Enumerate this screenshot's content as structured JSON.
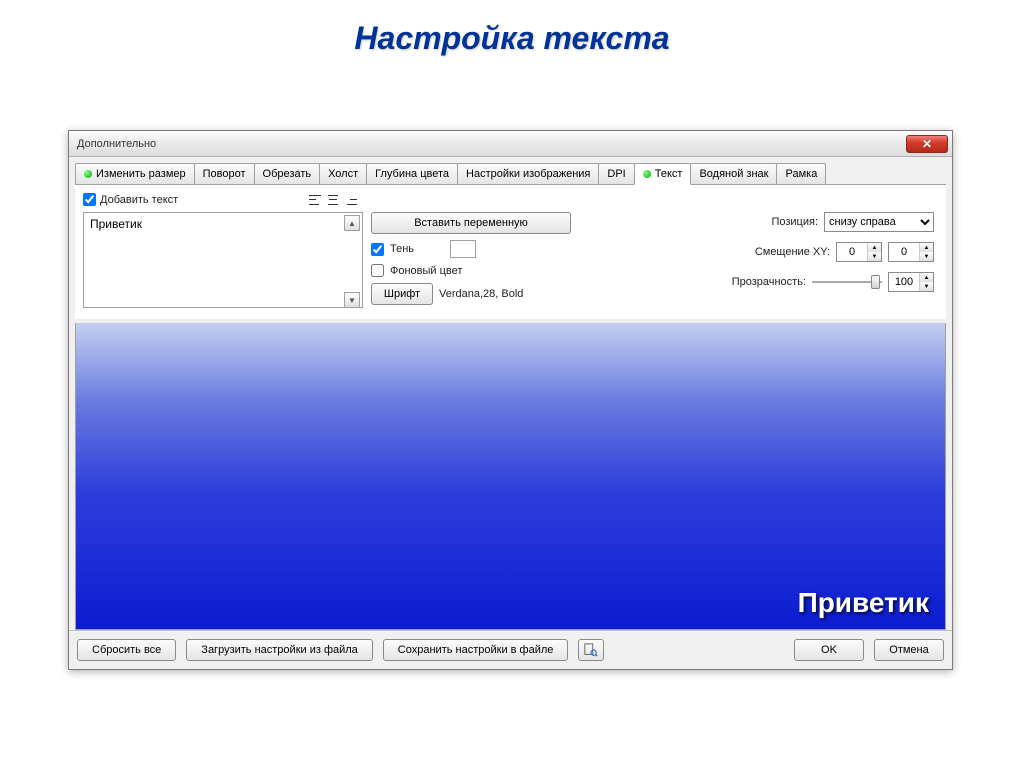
{
  "slide_title": "Настройка текста",
  "window": {
    "title": "Дополнительно"
  },
  "tabs": [
    {
      "label": "Изменить размер",
      "indicator": true
    },
    {
      "label": "Поворот"
    },
    {
      "label": "Обрезать"
    },
    {
      "label": "Холст"
    },
    {
      "label": "Глубина цвета"
    },
    {
      "label": "Настройки изображения"
    },
    {
      "label": "DPI"
    },
    {
      "label": "Текст",
      "indicator": true,
      "active": true
    },
    {
      "label": "Водяной знак"
    },
    {
      "label": "Рамка"
    }
  ],
  "text_tab": {
    "add_text_label": "Добавить текст",
    "text_value": "Приветик",
    "insert_variable": "Вставить переменную",
    "shadow_label": "Тень",
    "bgcolor_label": "Фоновый цвет",
    "font_button": "Шрифт",
    "font_info": "Verdana,28, Bold",
    "position_label": "Позиция:",
    "position_value": "снизу справа",
    "offset_label": "Смещение XY:",
    "offset_x": "0",
    "offset_y": "0",
    "opacity_label": "Прозрачность:",
    "opacity_value": "100"
  },
  "preview_text": "Приветик",
  "bottom": {
    "reset": "Сбросить все",
    "load": "Загрузить настройки из файла",
    "save": "Сохранить настройки в файле",
    "ok": "OK",
    "cancel": "Отмена"
  }
}
